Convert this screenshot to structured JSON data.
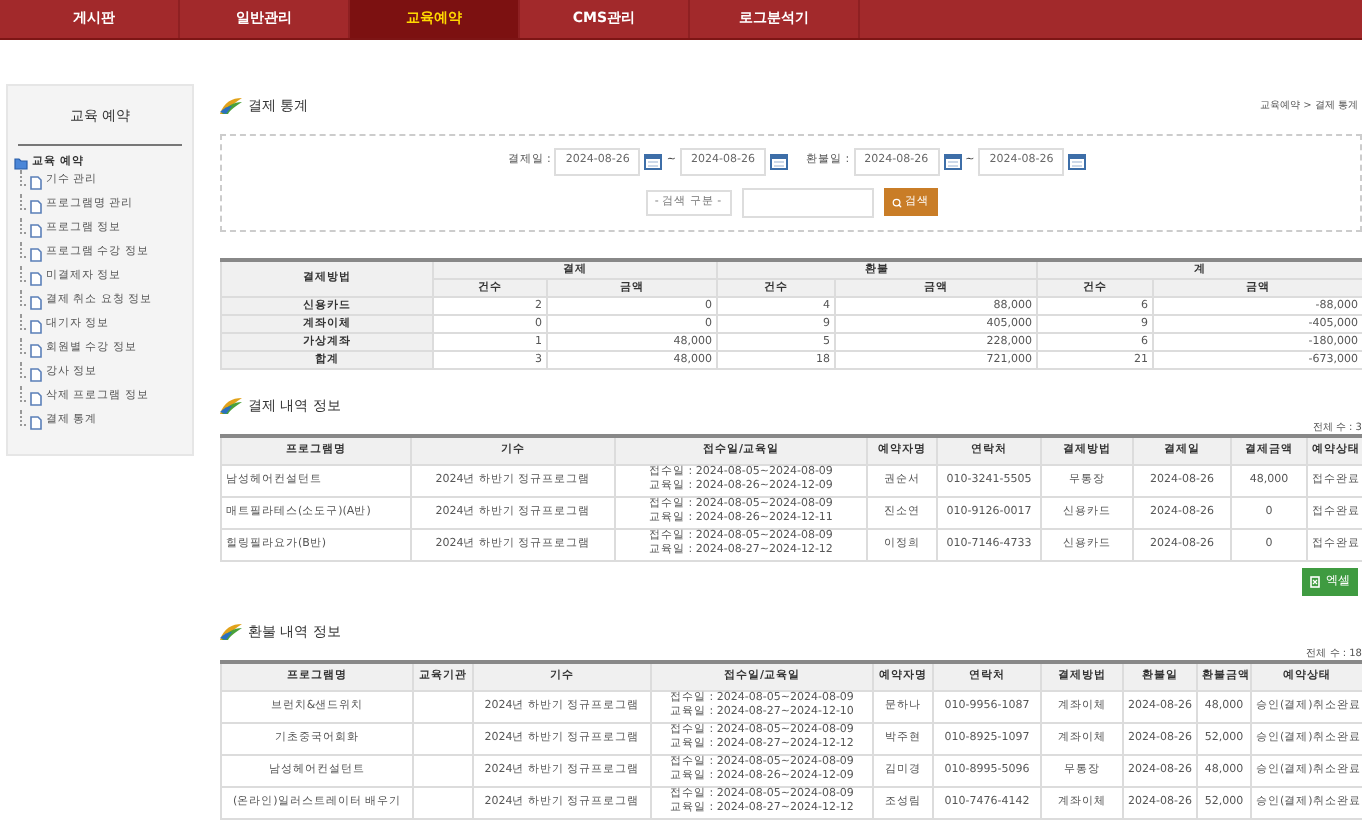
{
  "nav": {
    "tabs": [
      {
        "label": "게시판",
        "selected": false
      },
      {
        "label": "일반관리",
        "selected": false
      },
      {
        "label": "교육예약",
        "selected": true
      },
      {
        "label": "CMS관리",
        "selected": false
      },
      {
        "label": "로그분석기",
        "selected": false
      }
    ]
  },
  "sidebar": {
    "title": "교육 예약",
    "tree": {
      "label": "교육 예약",
      "children": [
        {
          "label": "기수 관리"
        },
        {
          "label": "프로그램명 관리"
        },
        {
          "label": "프로그램 정보"
        },
        {
          "label": "프로그램 수강 정보"
        },
        {
          "label": "미결제자 정보"
        },
        {
          "label": "결제 취소 요청 정보"
        },
        {
          "label": "대기자 정보"
        },
        {
          "label": "회원별 수강 정보"
        },
        {
          "label": "강사 정보"
        },
        {
          "label": "삭제 프로그램 정보"
        },
        {
          "label": "결제 통계"
        }
      ]
    }
  },
  "page": {
    "title": "결제 통계",
    "breadcrumb": "교육예약 > 결제 통계"
  },
  "search": {
    "date_ranges": [
      {
        "label": "결제일 :",
        "from": "2024-08-26",
        "separator": "~",
        "to": "2024-08-26"
      },
      {
        "label": "환불일 :",
        "from": "2024-08-26",
        "separator": "~",
        "to": "2024-08-26"
      }
    ],
    "category_select": "- 검색 구분 -",
    "search_button": "검색"
  },
  "stats": {
    "first_column": "결제방법",
    "groups": [
      "결제",
      "환불",
      "계"
    ],
    "sub_headers": [
      "건수",
      "금액",
      "건수",
      "금액",
      "건수",
      "금액"
    ],
    "rows": [
      {
        "label": "신용카드",
        "cells": [
          "2",
          "0",
          "4",
          "88,000",
          "6",
          "-88,000"
        ]
      },
      {
        "label": "계좌이체",
        "cells": [
          "0",
          "0",
          "9",
          "405,000",
          "9",
          "-405,000"
        ]
      },
      {
        "label": "가상계좌",
        "cells": [
          "1",
          "48,000",
          "5",
          "228,000",
          "6",
          "-180,000"
        ]
      },
      {
        "label": "합계",
        "cells": [
          "3",
          "48,000",
          "18",
          "721,000",
          "21",
          "-673,000"
        ]
      }
    ]
  },
  "payments": {
    "title": "결제 내역 정보",
    "total": "전체 수 : 3",
    "columns": [
      "프로그램명",
      "기수",
      "접수일/교육일",
      "예약자명",
      "연락처",
      "결제방법",
      "결제일",
      "결제금액",
      "예약상태"
    ],
    "rows": [
      {
        "program": "남성헤어컨설턴트",
        "term": "2024년 하반기 정규프로그램",
        "apply_period": "접수일 : 2024-08-05~2024-08-09",
        "class_period": "교육일 : 2024-08-26~2024-12-09",
        "name": "권순서",
        "phone": "010-3241-5505",
        "method": "무통장",
        "date": "2024-08-26",
        "amount": "48,000",
        "status": "접수완료"
      },
      {
        "program": "매트필라테스(소도구)(A반)",
        "term": "2024년 하반기 정규프로그램",
        "apply_period": "접수일 : 2024-08-05~2024-08-09",
        "class_period": "교육일 : 2024-08-26~2024-12-11",
        "name": "진소연",
        "phone": "010-9126-0017",
        "method": "신용카드",
        "date": "2024-08-26",
        "amount": "0",
        "status": "접수완료"
      },
      {
        "program": "힐링필라요가(B반)",
        "term": "2024년 하반기 정규프로그램",
        "apply_period": "접수일 : 2024-08-05~2024-08-09",
        "class_period": "교육일 : 2024-08-27~2024-12-12",
        "name": "이정희",
        "phone": "010-7146-4733",
        "method": "신용카드",
        "date": "2024-08-26",
        "amount": "0",
        "status": "접수완료"
      }
    ],
    "excel_button": "엑셀"
  },
  "refunds": {
    "title": "환불 내역 정보",
    "total": "전체 수 : 18",
    "columns": [
      "프로그램명",
      "교육기관",
      "기수",
      "접수일/교육일",
      "예약자명",
      "연락처",
      "결제방법",
      "환불일",
      "환불금액",
      "예약상태"
    ],
    "rows": [
      {
        "program": "브런치&샌드위치",
        "term": "2024년 하반기 정규프로그램",
        "apply_period": "접수일 : 2024-08-05~2024-08-09",
        "class_period": "교육일 : 2024-08-27~2024-12-10",
        "name": "문하나",
        "phone": "010-9956-1087",
        "method": "계좌이체",
        "date": "2024-08-26",
        "amount": "48,000",
        "status": "승인(결제)취소완료"
      },
      {
        "program": "기초중국어회화",
        "term": "2024년 하반기 정규프로그램",
        "apply_period": "접수일 : 2024-08-05~2024-08-09",
        "class_period": "교육일 : 2024-08-27~2024-12-12",
        "name": "박주현",
        "phone": "010-8925-1097",
        "method": "계좌이체",
        "date": "2024-08-26",
        "amount": "52,000",
        "status": "승인(결제)취소완료"
      },
      {
        "program": "남성헤어컨설턴트",
        "term": "2024년 하반기 정규프로그램",
        "apply_period": "접수일 : 2024-08-05~2024-08-09",
        "class_period": "교육일 : 2024-08-26~2024-12-09",
        "name": "김미경",
        "phone": "010-8995-5096",
        "method": "무통장",
        "date": "2024-08-26",
        "amount": "48,000",
        "status": "승인(결제)취소완료"
      },
      {
        "program": "(온라인)일러스트레이터 배우기",
        "term": "2024년 하반기 정규프로그램",
        "apply_period": "접수일 : 2024-08-05~2024-08-09",
        "class_period": "교육일 : 2024-08-27~2024-12-12",
        "name": "조성림",
        "phone": "010-7476-4142",
        "method": "계좌이체",
        "date": "2024-08-26",
        "amount": "52,000",
        "status": "승인(결제)취소완료"
      }
    ]
  }
}
